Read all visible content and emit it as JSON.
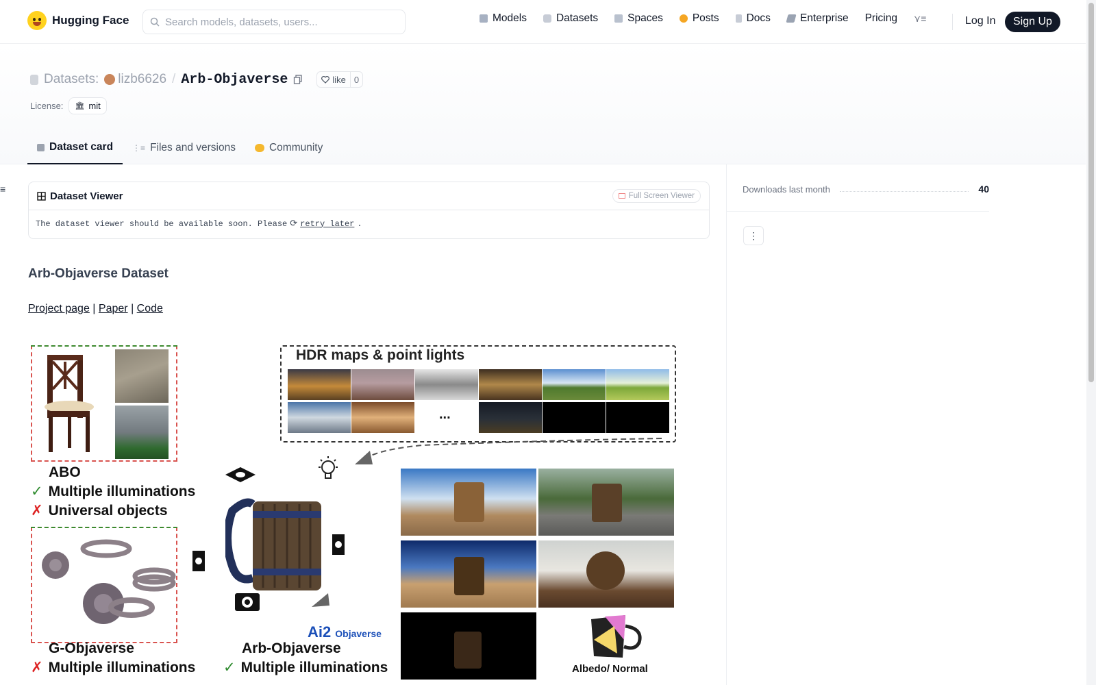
{
  "nav": {
    "brand": "Hugging Face",
    "search_placeholder": "Search models, datasets, users...",
    "links": [
      "Models",
      "Datasets",
      "Spaces",
      "Posts",
      "Docs",
      "Enterprise",
      "Pricing"
    ],
    "login": "Log In",
    "signup": "Sign Up"
  },
  "repo": {
    "kind": "Datasets:",
    "user": "lizb6626",
    "separator": "/",
    "name": "Arb-Objaverse",
    "like_label": "like",
    "like_count": "0",
    "license_label": "License:",
    "license_value": "mit"
  },
  "tabs": [
    {
      "label": "Dataset card",
      "active": true
    },
    {
      "label": "Files and versions",
      "active": false
    },
    {
      "label": "Community",
      "active": false
    }
  ],
  "viewer": {
    "title": "Dataset Viewer",
    "full_screen": "Full Screen Viewer",
    "message": "The dataset viewer should be available soon. Please",
    "retry": "retry later",
    "period": "."
  },
  "card": {
    "heading": "Arb-Objaverse Dataset",
    "links": [
      "Project page",
      "Paper",
      "Code"
    ],
    "sep": "|"
  },
  "sidebar": {
    "downloads_label": "Downloads last month",
    "downloads_value": "40"
  },
  "figure": {
    "hdr_title": "HDR maps & point lights",
    "ellipsis": "...",
    "abo_title": "ABO",
    "abo_check": "Multiple illuminations",
    "abo_cross": "Universal objects",
    "g_title": "G-Objaverse",
    "g_cross": "Multiple illuminations",
    "arb_title": "Arb-Objaverse",
    "arb_check": "Multiple illuminations",
    "ai2_label": "Objaverse",
    "ai2_mark": "Ai2",
    "albedo": "Albedo/ Normal"
  },
  "colors": {
    "accent": "#ffd21e",
    "signup_bg": "#111827"
  }
}
